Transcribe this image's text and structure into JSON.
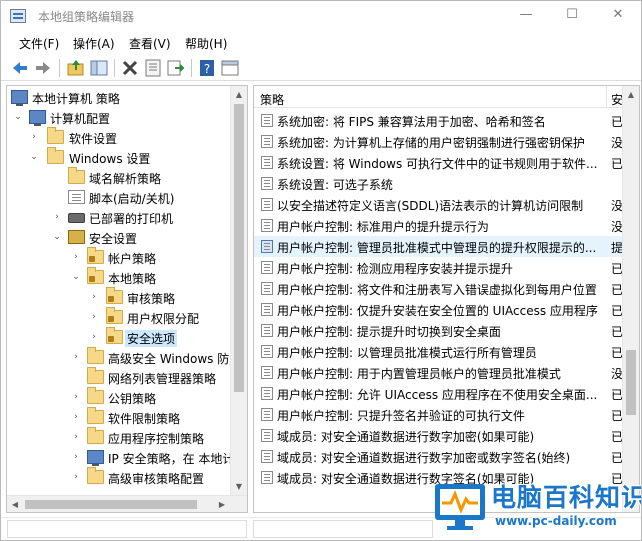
{
  "window": {
    "title": "本地组策略编辑器",
    "controls": {
      "minimize": "—",
      "maximize": "☐",
      "close": "✕"
    }
  },
  "menubar": {
    "items": [
      {
        "label": "文件(F)"
      },
      {
        "label": "操作(A)"
      },
      {
        "label": "查看(V)"
      },
      {
        "label": "帮助(H)"
      }
    ]
  },
  "toolbar": {
    "buttons": [
      "back-arrow-icon",
      "forward-arrow-icon",
      "up-folder-icon",
      "show-hide-tree-icon",
      "delete-icon",
      "properties-icon",
      "export-list-icon",
      "help-icon",
      "filter-view-icon"
    ]
  },
  "tree": {
    "items": [
      {
        "label": "本地计算机 策略",
        "icon": "computer-icon",
        "expander": ""
      },
      {
        "label": "计算机配置",
        "icon": "computer-icon",
        "expander": "⌄"
      },
      {
        "label": "软件设置",
        "icon": "folder-icon",
        "expander": "›"
      },
      {
        "label": "Windows 设置",
        "icon": "folder-icon",
        "expander": "⌄"
      },
      {
        "label": "域名解析策略",
        "icon": "folder-icon",
        "expander": ""
      },
      {
        "label": "脚本(启动/关机)",
        "icon": "script-icon",
        "expander": ""
      },
      {
        "label": "已部署的打印机",
        "icon": "printer-icon",
        "expander": "›"
      },
      {
        "label": "安全设置",
        "icon": "security-settings-icon",
        "expander": "⌄"
      },
      {
        "label": "帐户策略",
        "icon": "folder-lock-icon",
        "expander": "›"
      },
      {
        "label": "本地策略",
        "icon": "folder-lock-icon",
        "expander": "⌄"
      },
      {
        "label": "审核策略",
        "icon": "folder-lock-icon",
        "expander": "›"
      },
      {
        "label": "用户权限分配",
        "icon": "folder-lock-icon",
        "expander": "›"
      },
      {
        "label": "安全选项",
        "icon": "folder-lock-icon",
        "expander": "›",
        "selected": true
      },
      {
        "label": "高级安全 Windows 防",
        "icon": "folder-icon",
        "expander": "›"
      },
      {
        "label": "网络列表管理器策略",
        "icon": "folder-icon",
        "expander": ""
      },
      {
        "label": "公钥策略",
        "icon": "folder-icon",
        "expander": "›"
      },
      {
        "label": "软件限制策略",
        "icon": "folder-icon",
        "expander": "›"
      },
      {
        "label": "应用程序控制策略",
        "icon": "folder-icon",
        "expander": "›"
      },
      {
        "label": "IP 安全策略，在 本地计",
        "icon": "ip-security-icon",
        "expander": "›"
      },
      {
        "label": "高级审核策略配置",
        "icon": "folder-icon",
        "expander": "›"
      }
    ]
  },
  "list": {
    "columns": {
      "policy": "策略",
      "setting": "安"
    },
    "rows": [
      {
        "policy": "系统加密: 将 FIPS 兼容算法用于加密、哈希和签名",
        "setting": "已"
      },
      {
        "policy": "系统加密: 为计算机上存储的用户密钥强制进行强密钥保护",
        "setting": "没"
      },
      {
        "policy": "系统设置: 将 Windows 可执行文件中的证书规则用于软件...",
        "setting": "已"
      },
      {
        "policy": "系统设置: 可选子系统",
        "setting": ""
      },
      {
        "policy": "以安全描述符定义语言(SDDL)语法表示的计算机访问限制",
        "setting": "没"
      },
      {
        "policy": "用户帐户控制: 标准用户的提升提示行为",
        "setting": "没"
      },
      {
        "policy": "用户帐户控制: 管理员批准模式中管理员的提升权限提示的...",
        "setting": "提",
        "highlight": true
      },
      {
        "policy": "用户帐户控制: 检测应用程序安装并提示提升",
        "setting": "已"
      },
      {
        "policy": "用户帐户控制: 将文件和注册表写入错误虚拟化到每用户位置",
        "setting": "已"
      },
      {
        "policy": "用户帐户控制: 仅提升安装在安全位置的 UIAccess 应用程序",
        "setting": "已"
      },
      {
        "policy": "用户帐户控制: 提示提升时切换到安全桌面",
        "setting": "已"
      },
      {
        "policy": "用户帐户控制: 以管理员批准模式运行所有管理员",
        "setting": "已"
      },
      {
        "policy": "用户帐户控制: 用于内置管理员帐户的管理员批准模式",
        "setting": "没"
      },
      {
        "policy": "用户帐户控制: 允许 UIAccess 应用程序在不使用安全桌面...",
        "setting": "已"
      },
      {
        "policy": "用户帐户控制: 只提升签名并验证的可执行文件",
        "setting": "已"
      },
      {
        "policy": "域成员: 对安全通道数据进行数字加密(如果可能)",
        "setting": "已"
      },
      {
        "policy": "域成员: 对安全通道数据进行数字加密或数字签名(始终)",
        "setting": "已"
      },
      {
        "policy": "域成员: 对安全通道数据进行数字签名(如果可能)",
        "setting": "已"
      }
    ]
  },
  "watermark": {
    "title": "电脑百科知识",
    "url": "www.pc-daily.com"
  }
}
